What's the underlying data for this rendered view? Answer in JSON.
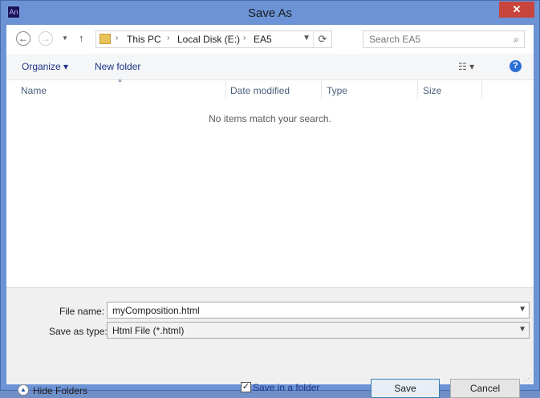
{
  "window": {
    "title": "Save As",
    "app_icon": "An",
    "close_glyph": "✕"
  },
  "nav": {
    "back_glyph": "←",
    "forward_glyph": "→",
    "recent_glyph": "▼",
    "up_glyph": "↑",
    "breadcrumb": [
      "This PC",
      "Local Disk (E:)",
      "EA5"
    ],
    "breadcrumb_sep": "›",
    "search_placeholder": "Search EA5"
  },
  "toolbar": {
    "organize": "Organize ▾",
    "new_folder": "New folder"
  },
  "columns": {
    "name": "Name",
    "date_modified": "Date modified",
    "type": "Type",
    "size": "Size"
  },
  "list": {
    "empty_message": "No items match your search."
  },
  "form": {
    "file_name_label": "File name:",
    "file_name_value": "myComposition.html",
    "save_type_label": "Save as type:",
    "save_type_value": "Html File (*.html)"
  },
  "footer": {
    "hide_folders": "Hide Folders",
    "save_in_folder": "Save in a folder",
    "save_in_folder_checked": true,
    "save": "Save",
    "cancel": "Cancel"
  }
}
